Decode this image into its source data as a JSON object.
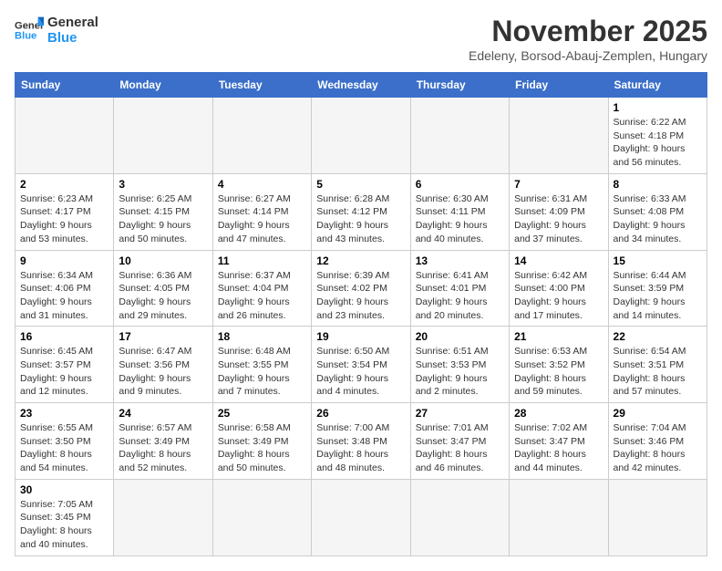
{
  "logo": {
    "line1": "General",
    "line2": "Blue"
  },
  "title": {
    "month_year": "November 2025",
    "location": "Edeleny, Borsod-Abauj-Zemplen, Hungary"
  },
  "headers": [
    "Sunday",
    "Monday",
    "Tuesday",
    "Wednesday",
    "Thursday",
    "Friday",
    "Saturday"
  ],
  "weeks": [
    [
      {
        "day": "",
        "info": ""
      },
      {
        "day": "",
        "info": ""
      },
      {
        "day": "",
        "info": ""
      },
      {
        "day": "",
        "info": ""
      },
      {
        "day": "",
        "info": ""
      },
      {
        "day": "",
        "info": ""
      },
      {
        "day": "1",
        "info": "Sunrise: 6:22 AM\nSunset: 4:18 PM\nDaylight: 9 hours\nand 56 minutes."
      }
    ],
    [
      {
        "day": "2",
        "info": "Sunrise: 6:23 AM\nSunset: 4:17 PM\nDaylight: 9 hours\nand 53 minutes."
      },
      {
        "day": "3",
        "info": "Sunrise: 6:25 AM\nSunset: 4:15 PM\nDaylight: 9 hours\nand 50 minutes."
      },
      {
        "day": "4",
        "info": "Sunrise: 6:27 AM\nSunset: 4:14 PM\nDaylight: 9 hours\nand 47 minutes."
      },
      {
        "day": "5",
        "info": "Sunrise: 6:28 AM\nSunset: 4:12 PM\nDaylight: 9 hours\nand 43 minutes."
      },
      {
        "day": "6",
        "info": "Sunrise: 6:30 AM\nSunset: 4:11 PM\nDaylight: 9 hours\nand 40 minutes."
      },
      {
        "day": "7",
        "info": "Sunrise: 6:31 AM\nSunset: 4:09 PM\nDaylight: 9 hours\nand 37 minutes."
      },
      {
        "day": "8",
        "info": "Sunrise: 6:33 AM\nSunset: 4:08 PM\nDaylight: 9 hours\nand 34 minutes."
      }
    ],
    [
      {
        "day": "9",
        "info": "Sunrise: 6:34 AM\nSunset: 4:06 PM\nDaylight: 9 hours\nand 31 minutes."
      },
      {
        "day": "10",
        "info": "Sunrise: 6:36 AM\nSunset: 4:05 PM\nDaylight: 9 hours\nand 29 minutes."
      },
      {
        "day": "11",
        "info": "Sunrise: 6:37 AM\nSunset: 4:04 PM\nDaylight: 9 hours\nand 26 minutes."
      },
      {
        "day": "12",
        "info": "Sunrise: 6:39 AM\nSunset: 4:02 PM\nDaylight: 9 hours\nand 23 minutes."
      },
      {
        "day": "13",
        "info": "Sunrise: 6:41 AM\nSunset: 4:01 PM\nDaylight: 9 hours\nand 20 minutes."
      },
      {
        "day": "14",
        "info": "Sunrise: 6:42 AM\nSunset: 4:00 PM\nDaylight: 9 hours\nand 17 minutes."
      },
      {
        "day": "15",
        "info": "Sunrise: 6:44 AM\nSunset: 3:59 PM\nDaylight: 9 hours\nand 14 minutes."
      }
    ],
    [
      {
        "day": "16",
        "info": "Sunrise: 6:45 AM\nSunset: 3:57 PM\nDaylight: 9 hours\nand 12 minutes."
      },
      {
        "day": "17",
        "info": "Sunrise: 6:47 AM\nSunset: 3:56 PM\nDaylight: 9 hours\nand 9 minutes."
      },
      {
        "day": "18",
        "info": "Sunrise: 6:48 AM\nSunset: 3:55 PM\nDaylight: 9 hours\nand 7 minutes."
      },
      {
        "day": "19",
        "info": "Sunrise: 6:50 AM\nSunset: 3:54 PM\nDaylight: 9 hours\nand 4 minutes."
      },
      {
        "day": "20",
        "info": "Sunrise: 6:51 AM\nSunset: 3:53 PM\nDaylight: 9 hours\nand 2 minutes."
      },
      {
        "day": "21",
        "info": "Sunrise: 6:53 AM\nSunset: 3:52 PM\nDaylight: 8 hours\nand 59 minutes."
      },
      {
        "day": "22",
        "info": "Sunrise: 6:54 AM\nSunset: 3:51 PM\nDaylight: 8 hours\nand 57 minutes."
      }
    ],
    [
      {
        "day": "23",
        "info": "Sunrise: 6:55 AM\nSunset: 3:50 PM\nDaylight: 8 hours\nand 54 minutes."
      },
      {
        "day": "24",
        "info": "Sunrise: 6:57 AM\nSunset: 3:49 PM\nDaylight: 8 hours\nand 52 minutes."
      },
      {
        "day": "25",
        "info": "Sunrise: 6:58 AM\nSunset: 3:49 PM\nDaylight: 8 hours\nand 50 minutes."
      },
      {
        "day": "26",
        "info": "Sunrise: 7:00 AM\nSunset: 3:48 PM\nDaylight: 8 hours\nand 48 minutes."
      },
      {
        "day": "27",
        "info": "Sunrise: 7:01 AM\nSunset: 3:47 PM\nDaylight: 8 hours\nand 46 minutes."
      },
      {
        "day": "28",
        "info": "Sunrise: 7:02 AM\nSunset: 3:47 PM\nDaylight: 8 hours\nand 44 minutes."
      },
      {
        "day": "29",
        "info": "Sunrise: 7:04 AM\nSunset: 3:46 PM\nDaylight: 8 hours\nand 42 minutes."
      }
    ],
    [
      {
        "day": "30",
        "info": "Sunrise: 7:05 AM\nSunset: 3:45 PM\nDaylight: 8 hours\nand 40 minutes."
      },
      {
        "day": "",
        "info": ""
      },
      {
        "day": "",
        "info": ""
      },
      {
        "day": "",
        "info": ""
      },
      {
        "day": "",
        "info": ""
      },
      {
        "day": "",
        "info": ""
      },
      {
        "day": "",
        "info": ""
      }
    ]
  ]
}
